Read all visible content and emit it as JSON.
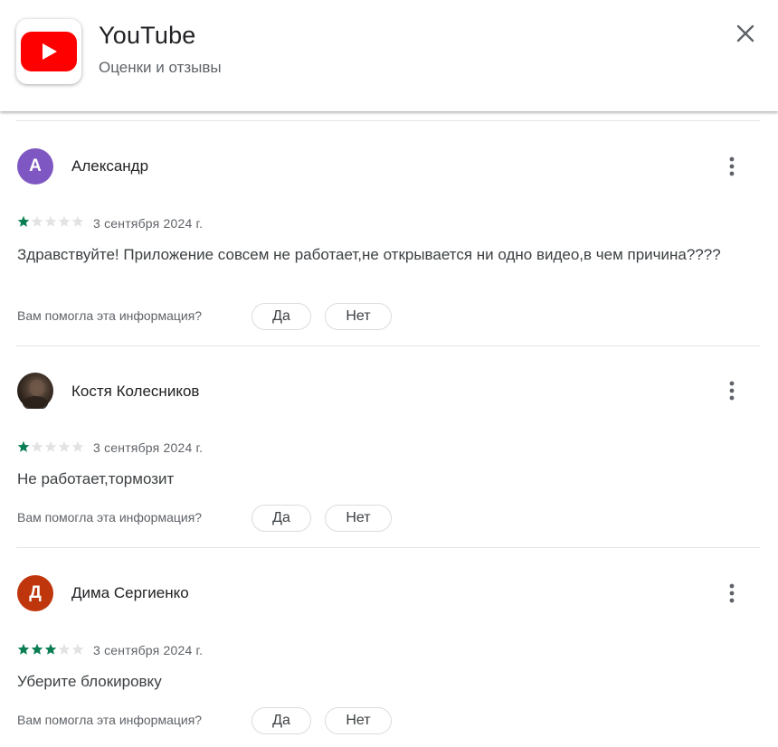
{
  "header": {
    "app_title": "YouTube",
    "subtitle": "Оценки и отзывы",
    "close_icon": "close-icon",
    "app_icon": "youtube-logo-icon"
  },
  "colors": {
    "star_filled": "#0a7e52",
    "star_empty": "#e3e3e3",
    "youtube_red": "#ff0000"
  },
  "reviews": [
    {
      "author": "Александр",
      "avatar_letter": "А",
      "avatar_color": "#7e57c2",
      "rating": 1,
      "date": "3 сентября 2024 г.",
      "text": "Здравствуйте! Приложение совсем не работает,не открывается ни одно видео,в чем причина????",
      "helpful_question": "Вам помогла эта информация?",
      "yes_label": "Да",
      "no_label": "Нет"
    },
    {
      "author": "Костя Колесников",
      "avatar_letter": "",
      "avatar_color": "",
      "rating": 1,
      "date": "3 сентября 2024 г.",
      "text": "Не работает,тормозит",
      "helpful_question": "Вам помогла эта информация?",
      "yes_label": "Да",
      "no_label": "Нет"
    },
    {
      "author": "Дима Сергиенко",
      "avatar_letter": "Д",
      "avatar_color": "#bf360c",
      "rating": 3,
      "date": "3 сентября 2024 г.",
      "text": "Уберите блокировку",
      "helpful_question": "Вам помогла эта информация?",
      "yes_label": "Да",
      "no_label": "Нет"
    }
  ]
}
